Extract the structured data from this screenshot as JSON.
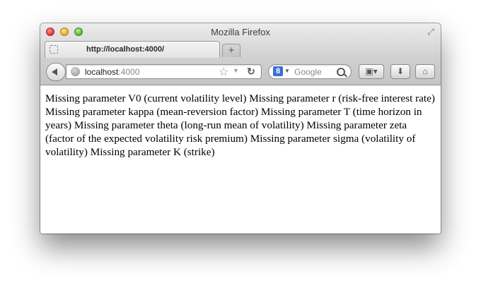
{
  "window": {
    "title": "Mozilla Firefox",
    "fullscreen_icon": "fullscreen-arrows-icon"
  },
  "tabs": [
    {
      "title": "http://localhost:4000/",
      "active": true
    }
  ],
  "new_tab_symbol": "+",
  "navigation": {
    "url_host": "localhost",
    "url_port": ":4000",
    "search_placeholder": "Google",
    "search_engine_letter": "8"
  },
  "page": {
    "text": "Missing parameter V0 (current volatility level) Missing parameter r (risk-free interest rate) Missing parameter kappa (mean-reversion factor) Missing parameter T (time horizon in years) Missing parameter theta (long-run mean of volatility) Missing parameter zeta (factor of the expected volatility risk premium) Missing parameter sigma (volatility of volatility) Missing parameter K (strike)"
  },
  "colors": {
    "close": "#e0443e",
    "minimize": "#f2b33a",
    "zoom": "#6bbf3f",
    "search_engine": "#3b6fd8"
  }
}
